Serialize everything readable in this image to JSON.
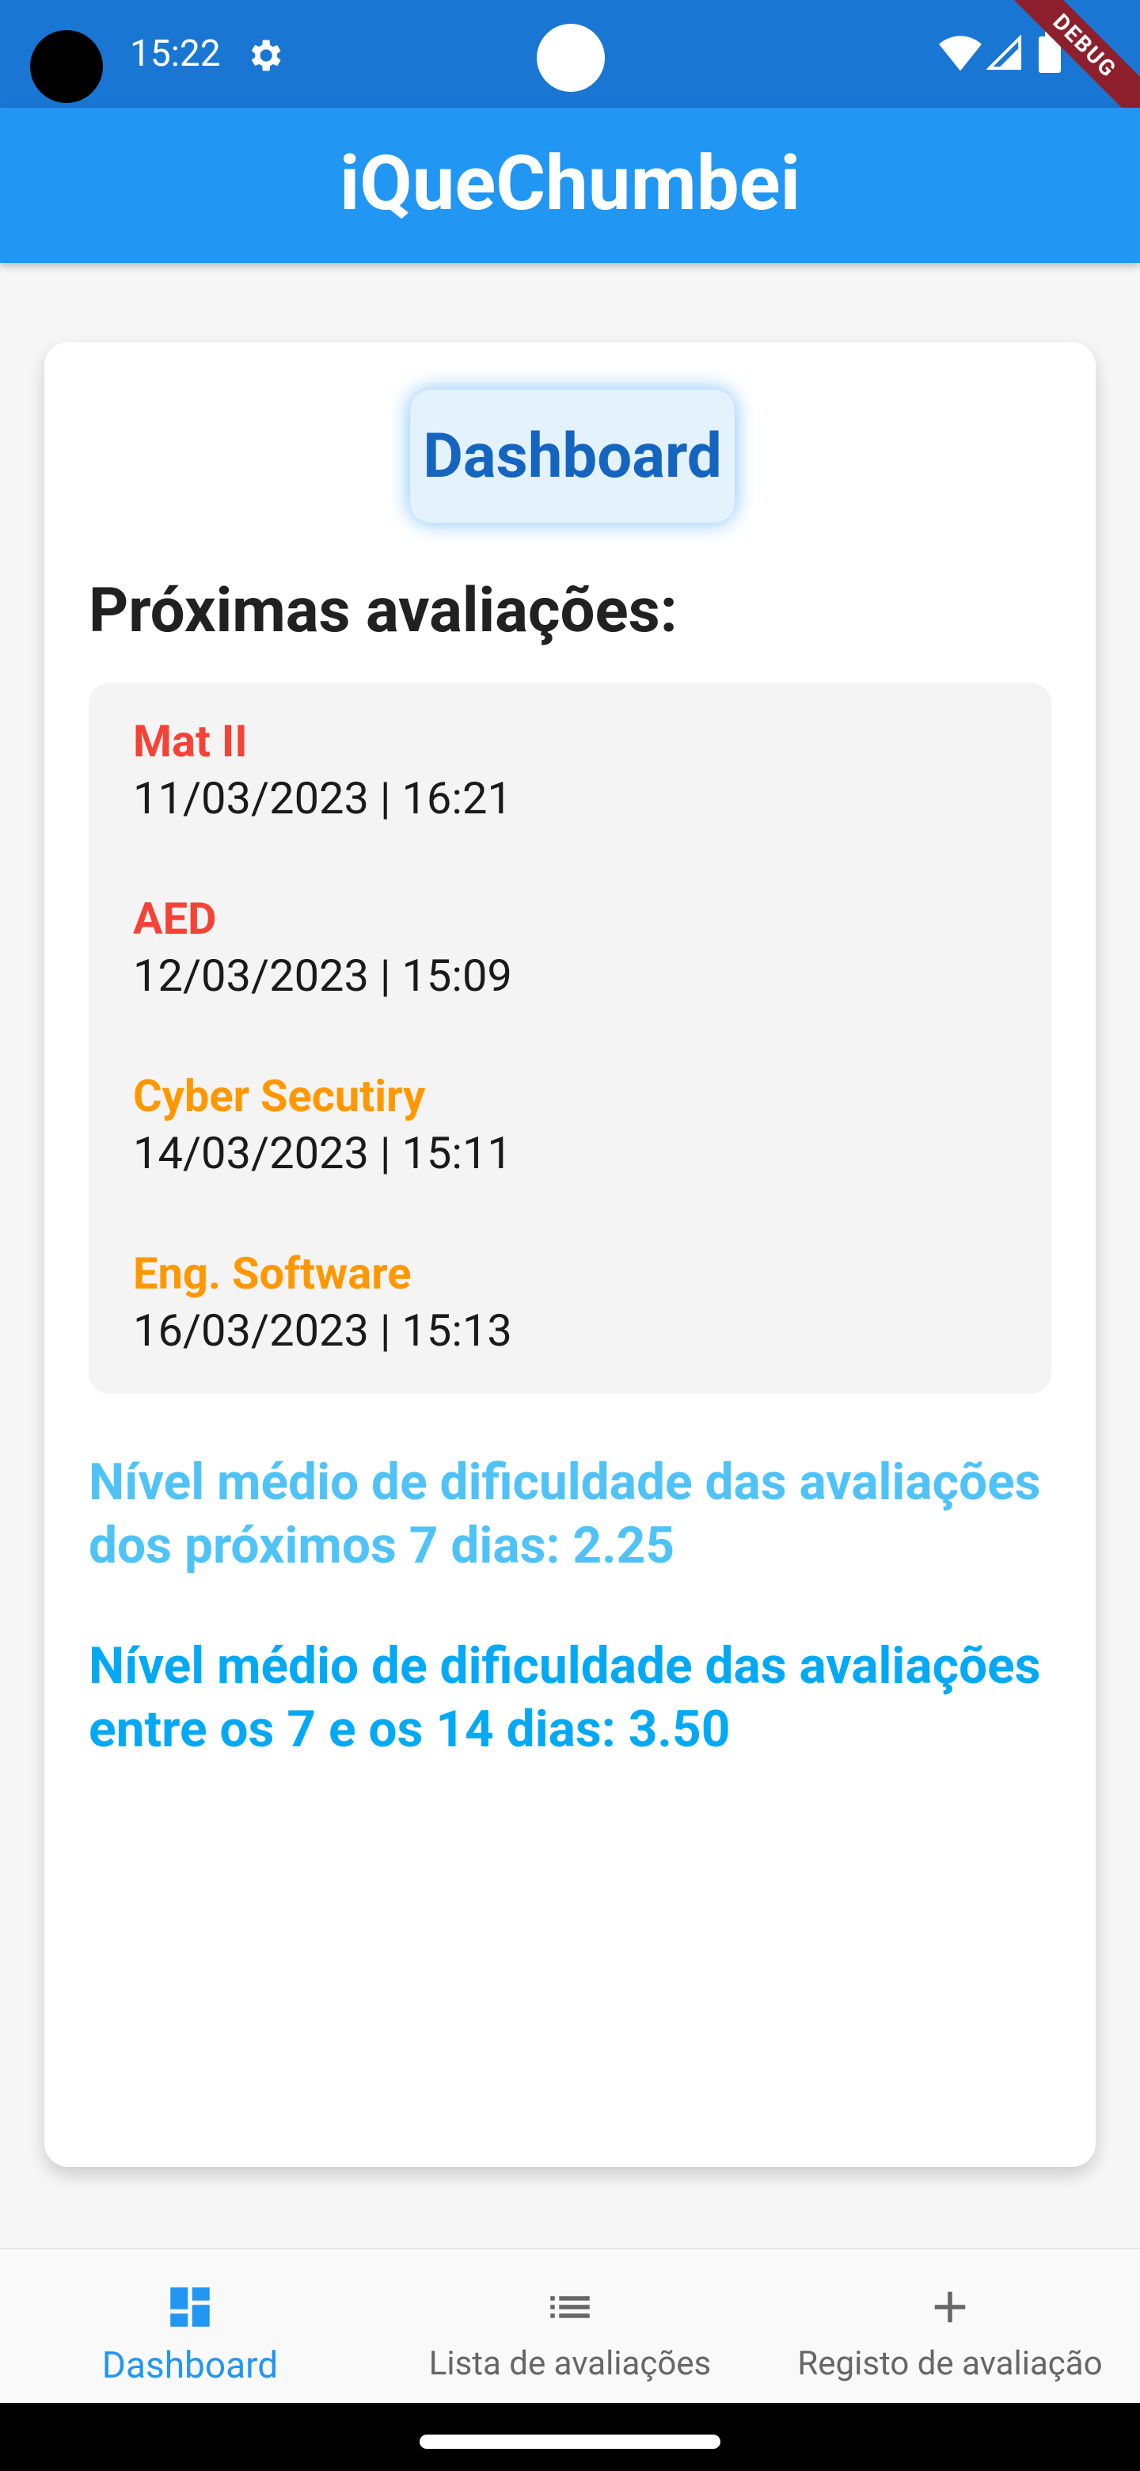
{
  "status_bar": {
    "time": "15:22",
    "debug_label": "DEBUG"
  },
  "app_bar": {
    "title": "iQueChumbei"
  },
  "card": {
    "chip_label": "Dashboard",
    "heading": "Próximas avaliações:",
    "evaluations": [
      {
        "subject": "Mat II",
        "datetime": "11/03/2023 | 16:21",
        "color": "#f44336"
      },
      {
        "subject": "AED",
        "datetime": "12/03/2023 | 15:09",
        "color": "#f44336"
      },
      {
        "subject": "Cyber Secutiry",
        "datetime": "14/03/2023 | 15:11",
        "color": "#ff9800"
      },
      {
        "subject": "Eng. Software",
        "datetime": "16/03/2023 | 15:13",
        "color": "#ff9800"
      }
    ],
    "difficulty_next_7": "Nível médio de dificuldade das avaliações dos próximos 7 dias: 2.25",
    "difficulty_7_to_14": "Nível médio de dificuldade das avaliações entre os 7 e os 14 dias: 3.50"
  },
  "bottom_nav": {
    "items": [
      {
        "label": "Dashboard",
        "icon": "dashboard-icon",
        "active": true
      },
      {
        "label": "Lista de avaliações",
        "icon": "list-icon",
        "active": false
      },
      {
        "label": "Registo de avaliação",
        "icon": "plus-icon",
        "active": false
      }
    ]
  },
  "colors": {
    "status_bar": "#1976d2",
    "app_bar": "#2196f3",
    "accent": "#2196f3",
    "chip_text": "#1565c0"
  }
}
